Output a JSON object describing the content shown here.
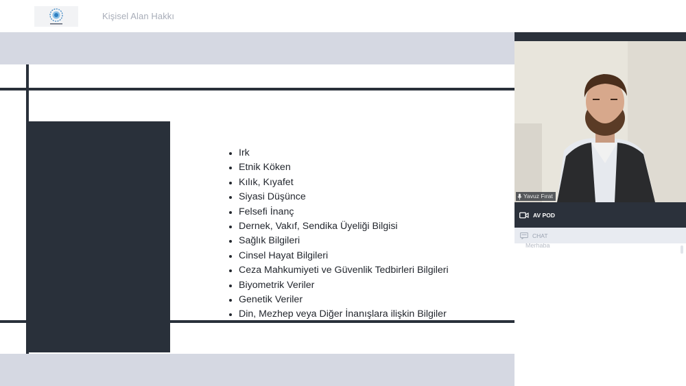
{
  "header": {
    "title": "Kişisel Alan Hakkı"
  },
  "slide": {
    "bullets": [
      "Irk",
      "Etnik Köken",
      "Kılık, Kıyafet",
      "Siyasi Düşünce",
      "Felsefi İnanç",
      "Dernek, Vakıf, Sendika Üyeliği Bilgisi",
      "Sağlık Bilgileri",
      "Cinsel Hayat Bilgileri",
      "Ceza Mahkumiyeti ve Güvenlik Tedbirleri Bilgileri",
      "Biyometrik Veriler",
      "Genetik Veriler",
      "Din, Mezhep veya Diğer İnanışlara ilişkin Bilgiler"
    ]
  },
  "video": {
    "participant_name": "Yavuz Fırat",
    "icon": "microphone-icon"
  },
  "pods": {
    "av_label": "AV POD",
    "av_icon": "video-camera-icon",
    "chat_label": "CHAT",
    "chat_icon": "chat-icon"
  },
  "chat": {
    "messages": [
      "Merhaba"
    ]
  },
  "colors": {
    "dark": "#29303a",
    "stage_bg": "#d5d8e2",
    "panel_dark": "#2b313b"
  }
}
